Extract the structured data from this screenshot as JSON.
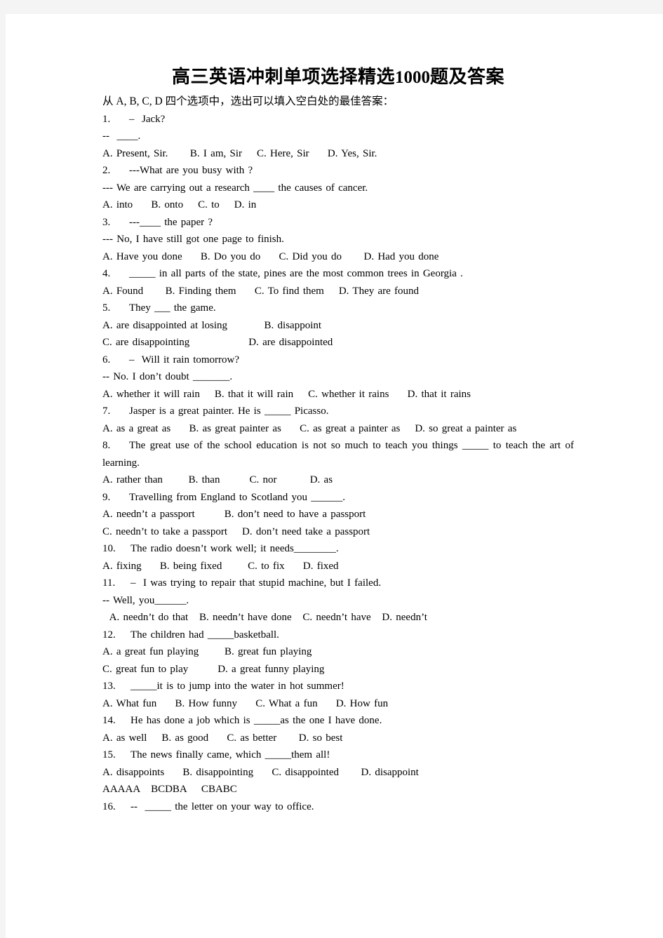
{
  "document": {
    "title_main": "高三英语冲刺单项选择精选",
    "title_number": "1000",
    "title_tail": "题及答案",
    "instruction": "从 A, B, C, D 四个选项中，选出可以填入空白处的最佳答案："
  },
  "questions": [
    {
      "number": "1.",
      "stem_lines": [
        "–  Jack?",
        "--  ____."
      ],
      "options_lines": [
        "A. Present, Sir.      B. I am, Sir    C. Here, Sir     D. Yes, Sir."
      ]
    },
    {
      "number": "2.",
      "stem_lines": [
        "---What are you busy with ?",
        "--- We are carrying out a research ____ the causes of cancer."
      ],
      "options_lines": [
        "A. into     B. onto    C. to    D. in"
      ]
    },
    {
      "number": "3.",
      "stem_lines": [
        "---____ the paper ?",
        "--- No, I have still got one page to finish."
      ],
      "options_lines": [
        "A. Have you done     B. Do you do     C. Did you do      D. Had you done"
      ]
    },
    {
      "number": "4.",
      "stem_lines": [
        "_____ in all parts of the state, pines are the most common trees in Georgia ."
      ],
      "options_lines": [
        "A. Found      B. Finding them     C. To find them    D. They are found"
      ]
    },
    {
      "number": "5.",
      "stem_lines": [
        "They ___ the game."
      ],
      "options_lines": [
        "A. are disappointed at losing          B. disappoint",
        "C. are disappointing                D. are disappointed"
      ]
    },
    {
      "number": "6.",
      "stem_lines": [
        "–  Will it rain tomorrow?",
        "-- No. I don’t doubt _______."
      ],
      "options_lines": [
        "A. whether it will rain    B. that it will rain    C. whether it rains     D. that it rains"
      ]
    },
    {
      "number": "7.",
      "stem_lines": [
        "Jasper is a great painter. He is _____ Picasso."
      ],
      "options_lines": [
        "A. as a great as     B. as great painter as     C. as great a painter as    D. so great a painter as"
      ]
    },
    {
      "number": "8.",
      "stem_lines": [
        "The great use of the school education is not so much to teach you things _____ to teach the art of learning."
      ],
      "options_lines": [
        "A. rather than       B. than        C. nor         D. as"
      ]
    },
    {
      "number": "9.",
      "stem_lines": [
        "Travelling from England to Scotland you ______."
      ],
      "options_lines": [
        "A. needn’t a passport        B. don’t need to have a passport",
        "C. needn’t to take a passport    D. don’t need take a passport"
      ]
    },
    {
      "number": "10.",
      "stem_lines": [
        "The radio doesn’t work well; it needs________."
      ],
      "options_lines": [
        "A. fixing     B. being fixed       C. to fix     D. fixed"
      ]
    },
    {
      "number": "11.",
      "stem_lines": [
        "–  I was trying to repair that stupid machine, but I failed.",
        "-- Well, you______."
      ],
      "options_lines": [
        "  A. needn’t do that   B. needn’t have done   C. needn’t have   D. needn’t"
      ]
    },
    {
      "number": "12.",
      "stem_lines": [
        "The children had _____basketball."
      ],
      "options_lines": [
        "A. a great fun playing       B. great fun playing",
        "C. great fun to play        D. a great funny playing"
      ]
    },
    {
      "number": "13.",
      "stem_lines": [
        "_____it is to jump into the water in hot summer!"
      ],
      "options_lines": [
        "A. What fun     B. How funny     C. What a fun     D. How fun"
      ]
    },
    {
      "number": "14.",
      "stem_lines": [
        "He has done a job which is _____as the one I have done."
      ],
      "options_lines": [
        "A. as well    B. as good     C. as better      D. so best"
      ]
    },
    {
      "number": "15.",
      "stem_lines": [
        "The news finally came, which _____them all!"
      ],
      "options_lines": [
        "A. disappoints     B. disappointing     C. disappointed      D. disappoint"
      ]
    }
  ],
  "answer_key": "AAAAA   BCDBA    CBABC",
  "trailing_question": {
    "number": "16.",
    "stem_lines": [
      "--  _____ the letter on your way to office."
    ]
  }
}
